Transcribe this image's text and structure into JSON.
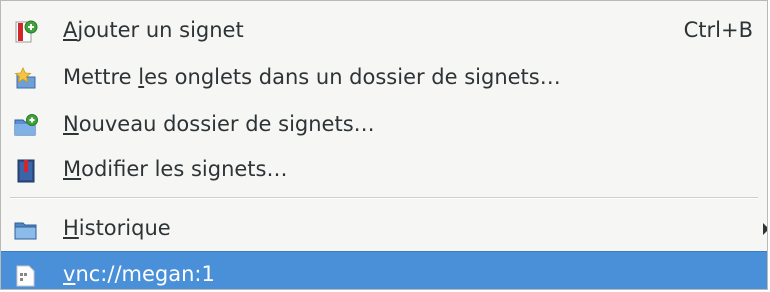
{
  "menu": {
    "items": [
      {
        "label": "Ajouter un signet",
        "mnemonic": "A",
        "shortcut": "Ctrl+B",
        "icon": "bookmark-add-icon"
      },
      {
        "label": "Mettre les onglets dans un dossier de signets…",
        "mnemonic": "l",
        "icon": "bookmark-tabs-folder-icon"
      },
      {
        "label": "Nouveau dossier de signets…",
        "mnemonic": "N",
        "icon": "new-folder-icon"
      },
      {
        "label": "Modifier les signets…",
        "mnemonic": "M",
        "icon": "edit-bookmarks-icon"
      },
      {
        "label": "Historique",
        "mnemonic": "H",
        "icon": "folder-icon",
        "has_submenu": true
      },
      {
        "label": "vnc://megan:1",
        "mnemonic": "v",
        "icon": "page-icon",
        "selected": true
      }
    ]
  },
  "colors": {
    "menu_background": "#f6f6f5",
    "selection": "#4a90d9",
    "text": "#2e3436"
  }
}
